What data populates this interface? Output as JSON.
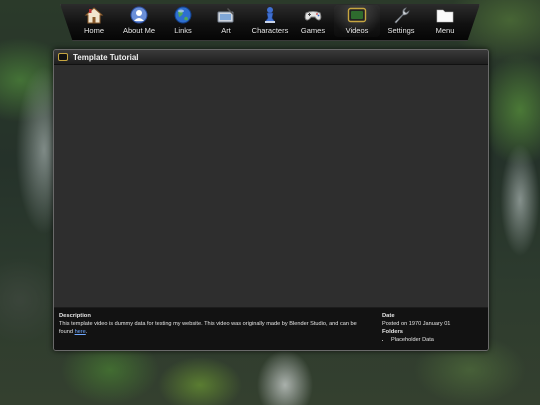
{
  "nav": {
    "items": [
      {
        "label": "Home",
        "icon": "home-icon"
      },
      {
        "label": "About Me",
        "icon": "user-globe-icon"
      },
      {
        "label": "Links",
        "icon": "globe-icon"
      },
      {
        "label": "Art",
        "icon": "tablet-pen-icon"
      },
      {
        "label": "Characters",
        "icon": "chess-pawn-icon"
      },
      {
        "label": "Games",
        "icon": "gamepad-icon"
      },
      {
        "label": "Videos",
        "icon": "tv-icon",
        "active": true
      },
      {
        "label": "Settings",
        "icon": "wrench-icon"
      },
      {
        "label": "Menu",
        "icon": "folder-icon"
      }
    ]
  },
  "panel": {
    "title": "Template Tutorial"
  },
  "footer": {
    "description_heading": "Description",
    "description_text": "This template video is dummy data for testing my website. This video was originally made by Blender Studio, and can be found ",
    "description_link": "here",
    "description_end": ".",
    "date_heading": "Date",
    "date_text": "Posted on 1970 January 01",
    "folders_heading": "Folders",
    "folders": [
      "Placeholder Data"
    ]
  },
  "colors": {
    "accent": "#c7a640",
    "link": "#6fa8ff",
    "panel_bg": "#2b2b2b",
    "footer_bg": "#121212"
  }
}
